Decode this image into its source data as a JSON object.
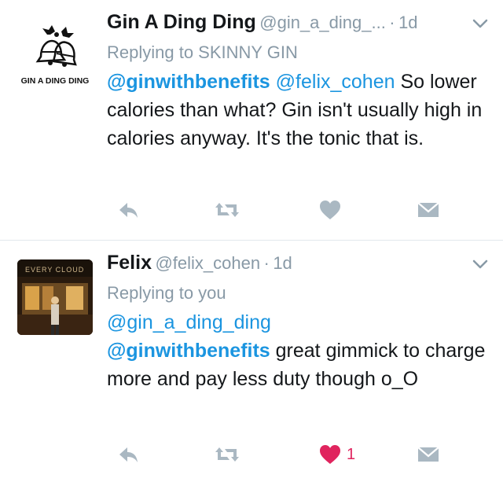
{
  "tweets": [
    {
      "author_name": "Gin A Ding Ding",
      "handle": "@gin_a_ding_...",
      "dot": "·",
      "time": "1d",
      "replying_to": "Replying to SKINNY GIN",
      "avatar_logo_text": "GIN A DING DING",
      "mentions": [
        "@ginwithbenefits",
        "@felix_cohen"
      ],
      "text": " So lower calories than what? Gin isn't usually high in calories anyway. It's the tonic that is.",
      "like_count": "",
      "liked": false
    },
    {
      "author_name": "Felix",
      "handle": "@felix_cohen",
      "dot": "·",
      "time": "1d",
      "replying_to": "Replying to you",
      "avatar_sign_text": "EVERY CLOUD",
      "mention_line": "@gin_a_ding_ding",
      "mention_bold": "@ginwithbenefits",
      "text": " great gimmick to charge more and pay less duty though o_O",
      "like_count": "1",
      "liked": true
    }
  ],
  "icons": [
    "reply-icon",
    "retweet-icon",
    "like-icon",
    "dm-icon",
    "chevron-down-icon"
  ],
  "colors": {
    "link": "#1b95e0",
    "muted": "#8899a6",
    "like_active": "#e0245e",
    "icon": "#aab8c2"
  }
}
